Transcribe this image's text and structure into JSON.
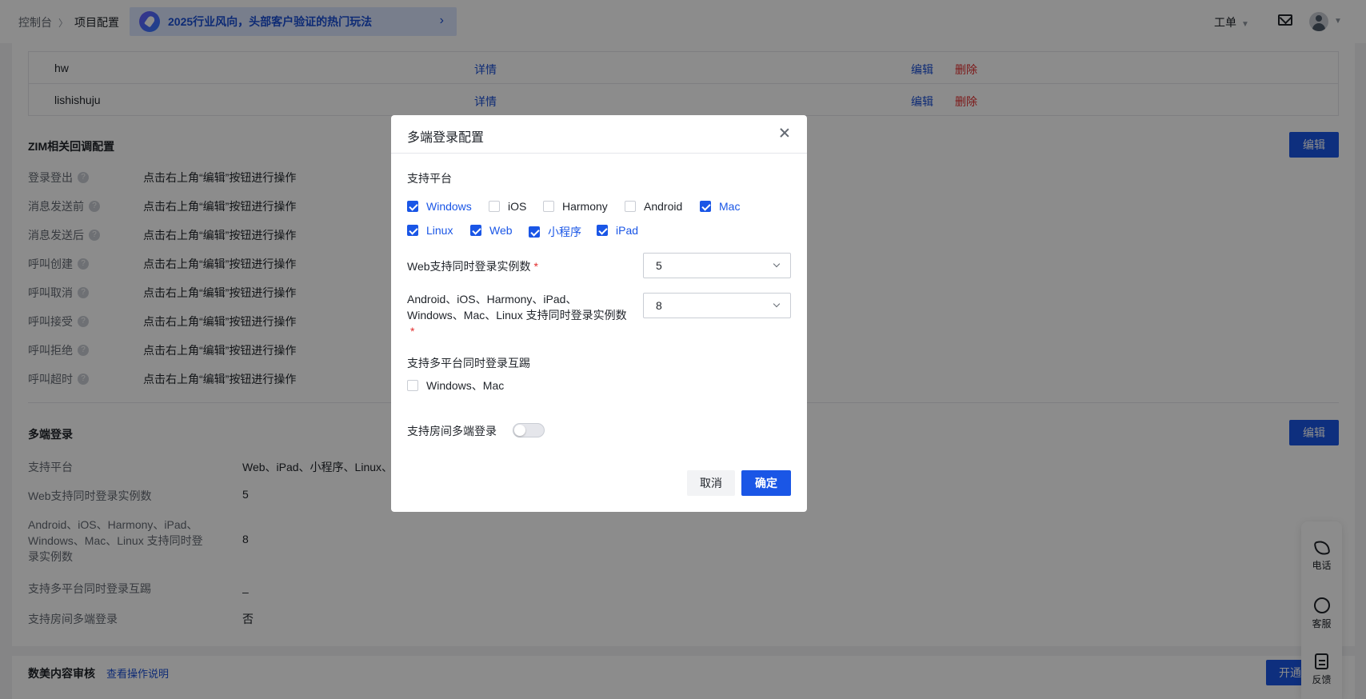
{
  "header": {
    "breadcrumb": [
      "控制台",
      "项目配置"
    ],
    "promo_text": "2025行业风向，头部客户验证的热门玩法",
    "ticket_label": "工单"
  },
  "table": {
    "rows": [
      {
        "name": "hw",
        "detail": "详情",
        "edit": "编辑",
        "delete": "删除"
      },
      {
        "name": "lishishuju",
        "detail": "详情",
        "edit": "编辑",
        "delete": "删除"
      }
    ]
  },
  "zim": {
    "title": "ZIM相关回调配置",
    "edit_label": "编辑",
    "items": [
      {
        "label": "登录登出",
        "value": "点击右上角“编辑”按钮进行操作"
      },
      {
        "label": "消息发送前",
        "value": "点击右上角“编辑”按钮进行操作"
      },
      {
        "label": "消息发送后",
        "value": "点击右上角“编辑”按钮进行操作"
      },
      {
        "label": "呼叫创建",
        "value": "点击右上角“编辑”按钮进行操作"
      },
      {
        "label": "呼叫取消",
        "value": "点击右上角“编辑”按钮进行操作"
      },
      {
        "label": "呼叫接受",
        "value": "点击右上角“编辑”按钮进行操作"
      },
      {
        "label": "呼叫拒绝",
        "value": "点击右上角“编辑”按钮进行操作"
      },
      {
        "label": "呼叫超时",
        "value": "点击右上角“编辑”按钮进行操作"
      }
    ]
  },
  "multi": {
    "title": "多端登录",
    "edit_label": "编辑",
    "items": [
      {
        "label": "支持平台",
        "value": "Web、iPad、小程序、Linux、"
      },
      {
        "label": "Web支持同时登录实例数",
        "value": "5"
      },
      {
        "label": "Android、iOS、Harmony、iPad、Windows、Mac、Linux 支持同时登录实例数",
        "value": "8"
      },
      {
        "label": "支持多平台同时登录互踢",
        "value": "–"
      },
      {
        "label": "支持房间多端登录",
        "value": "否"
      }
    ]
  },
  "moderation": {
    "title": "数美内容审核",
    "link": "查看操作说明",
    "button": "开通"
  },
  "float_bar": [
    {
      "icon": "phone-icon",
      "label": "电话"
    },
    {
      "icon": "headset-icon",
      "label": "客服"
    },
    {
      "icon": "feedback-icon",
      "label": "反馈"
    }
  ],
  "modal": {
    "title": "多端登录配置",
    "platforms_label": "支持平台",
    "platforms": [
      {
        "label": "Windows",
        "checked": true
      },
      {
        "label": "iOS",
        "checked": false
      },
      {
        "label": "Harmony",
        "checked": false
      },
      {
        "label": "Android",
        "checked": false
      },
      {
        "label": "Mac",
        "checked": true
      },
      {
        "label": "Linux",
        "checked": true
      },
      {
        "label": "Web",
        "checked": true
      },
      {
        "label": "小程序",
        "checked": true
      },
      {
        "label": "iPad",
        "checked": true
      }
    ],
    "web_instances_label": "Web支持同时登录实例数",
    "web_instances_value": "5",
    "other_instances_label": "Android、iOS、Harmony、iPad、Windows、Mac、Linux 支持同时登录实例数",
    "other_instances_value": "8",
    "kick_label": "支持多平台同时登录互踢",
    "kick_option": "Windows、Mac",
    "kick_checked": false,
    "room_label": "支持房间多端登录",
    "room_enabled": false,
    "cancel_label": "取消",
    "ok_label": "确定",
    "accent_color": "#1a56e6"
  }
}
